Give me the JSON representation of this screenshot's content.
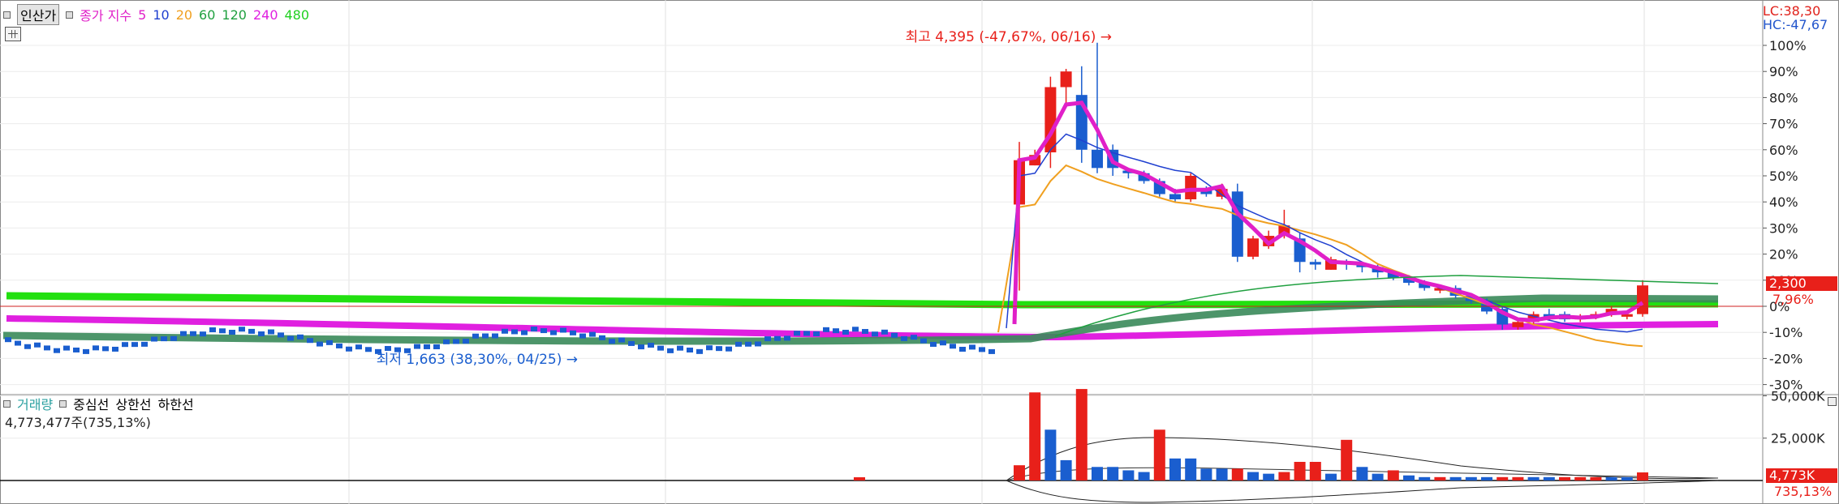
{
  "price_legend": {
    "toggle": "인산가",
    "label": "종가 지수",
    "periods": [
      {
        "label": "5",
        "color": "#e020c8"
      },
      {
        "label": "10",
        "color": "#2040d0"
      },
      {
        "label": "20",
        "color": "#f0a020"
      },
      {
        "label": "60",
        "color": "#20a040"
      },
      {
        "label": "120",
        "color": "#20a040"
      },
      {
        "label": "240",
        "color": "#e020e0"
      },
      {
        "label": "480",
        "color": "#20d020"
      }
    ]
  },
  "vol_legend": {
    "label": "거래량",
    "items": [
      "중심선",
      "상한선",
      "하한선"
    ],
    "readout": "4,773,477주(735,13%)"
  },
  "corner": {
    "lc": "LC:38,30",
    "hc": "HC:-47,67"
  },
  "colors": {
    "up": "#e8201a",
    "down": "#1a5ecf",
    "ma5": "#e020c8",
    "ma10": "#2040d0",
    "ma20": "#f0a020",
    "ma60": "#20a040",
    "ma120": "#3a8a5a",
    "ma240": "#e020e0",
    "ma480": "#22e010"
  },
  "chart_data": {
    "type": "candlestick",
    "yaxis": {
      "ticks": [
        "100%",
        "90%",
        "80%",
        "70%",
        "60%",
        "50%",
        "40%",
        "30%",
        "20%",
        "10%",
        "0%",
        "-10%",
        "-20%",
        "-30%"
      ],
      "values": [
        100,
        90,
        80,
        70,
        60,
        50,
        40,
        30,
        20,
        10,
        0,
        -10,
        -20,
        -30
      ]
    },
    "volume_axis": {
      "ticks": [
        "50,000K",
        "25,000K"
      ],
      "values": [
        50000,
        25000
      ]
    },
    "annotations": {
      "high": "최고 4,395 (-47,67%, 06/16)",
      "low": "최저 1,663 (38,30%, 04/25)",
      "current_price": "2,300",
      "current_pct": "7,96%",
      "current_volume": "4,773K",
      "current_volume_pct": "735,13%"
    },
    "candles": [
      {
        "o": 39,
        "c": 56,
        "h": 63,
        "l": 6
      },
      {
        "o": 54,
        "c": 58,
        "h": 60,
        "l": 54
      },
      {
        "o": 59,
        "c": 84,
        "h": 88,
        "l": 53
      },
      {
        "o": 84,
        "c": 90,
        "h": 91,
        "l": 78
      },
      {
        "o": 81,
        "c": 60,
        "h": 92,
        "l": 55
      },
      {
        "o": 60,
        "c": 53,
        "h": 101,
        "l": 51
      },
      {
        "o": 60,
        "c": 53,
        "h": 62,
        "l": 50
      },
      {
        "o": 52,
        "c": 51,
        "h": 53,
        "l": 49
      },
      {
        "o": 51,
        "c": 48,
        "h": 52,
        "l": 47
      },
      {
        "o": 48,
        "c": 43,
        "h": 49,
        "l": 42
      },
      {
        "o": 43,
        "c": 41,
        "h": 45,
        "l": 40
      },
      {
        "o": 41,
        "c": 50,
        "h": 51,
        "l": 40
      },
      {
        "o": 45,
        "c": 43,
        "h": 46,
        "l": 42
      },
      {
        "o": 42,
        "c": 45,
        "h": 47,
        "l": 41
      },
      {
        "o": 44,
        "c": 19,
        "h": 47,
        "l": 17
      },
      {
        "o": 19,
        "c": 26,
        "h": 27,
        "l": 18
      },
      {
        "o": 23,
        "c": 27,
        "h": 29,
        "l": 22
      },
      {
        "o": 27,
        "c": 31,
        "h": 37,
        "l": 26
      },
      {
        "o": 26,
        "c": 17,
        "h": 28,
        "l": 13
      },
      {
        "o": 17,
        "c": 16,
        "h": 18,
        "l": 14
      },
      {
        "o": 14,
        "c": 18,
        "h": 19,
        "l": 14
      },
      {
        "o": 17,
        "c": 16,
        "h": 18,
        "l": 14
      },
      {
        "o": 16,
        "c": 15,
        "h": 17,
        "l": 13
      },
      {
        "o": 15,
        "c": 13,
        "h": 16,
        "l": 11
      },
      {
        "o": 13,
        "c": 11,
        "h": 14,
        "l": 10
      },
      {
        "o": 11,
        "c": 9,
        "h": 12,
        "l": 8
      },
      {
        "o": 9,
        "c": 7,
        "h": 10,
        "l": 6
      },
      {
        "o": 6,
        "c": 7,
        "h": 8,
        "l": 5
      },
      {
        "o": 7,
        "c": 4,
        "h": 8,
        "l": 3
      },
      {
        "o": 4,
        "c": 2,
        "h": 5,
        "l": 1
      },
      {
        "o": 2,
        "c": -2,
        "h": 3,
        "l": -3
      },
      {
        "o": -1,
        "c": -7,
        "h": 0,
        "l": -9
      },
      {
        "o": -8,
        "c": -6,
        "h": -5,
        "l": -9
      },
      {
        "o": -6,
        "c": -3,
        "h": -2,
        "l": -7
      },
      {
        "o": -3,
        "c": -4,
        "h": -1,
        "l": -5
      },
      {
        "o": -3,
        "c": -5,
        "h": -2,
        "l": -6
      },
      {
        "o": -5,
        "c": -4,
        "h": -3,
        "l": -6
      },
      {
        "o": -4,
        "c": -3,
        "h": -2,
        "l": -5
      },
      {
        "o": -3,
        "c": -1,
        "h": 0,
        "l": -4
      },
      {
        "o": -4,
        "c": -3,
        "h": -2,
        "l": -5
      },
      {
        "o": -3,
        "c": 8,
        "h": 10,
        "l": -4
      }
    ],
    "volumes": [
      {
        "v": 9000,
        "up": true
      },
      {
        "v": 52000,
        "up": true
      },
      {
        "v": 30000,
        "up": false
      },
      {
        "v": 12000,
        "up": false
      },
      {
        "v": 54000,
        "up": true
      },
      {
        "v": 8000,
        "up": false
      },
      {
        "v": 8000,
        "up": false
      },
      {
        "v": 6000,
        "up": false
      },
      {
        "v": 5000,
        "up": false
      },
      {
        "v": 30000,
        "up": true
      },
      {
        "v": 13000,
        "up": false
      },
      {
        "v": 13000,
        "up": false
      },
      {
        "v": 7000,
        "up": false
      },
      {
        "v": 7000,
        "up": false
      },
      {
        "v": 7000,
        "up": true
      },
      {
        "v": 5000,
        "up": false
      },
      {
        "v": 4000,
        "up": false
      },
      {
        "v": 5000,
        "up": true
      },
      {
        "v": 11000,
        "up": true
      },
      {
        "v": 11000,
        "up": true
      },
      {
        "v": 4000,
        "up": false
      },
      {
        "v": 24000,
        "up": true
      },
      {
        "v": 8000,
        "up": false
      },
      {
        "v": 4000,
        "up": false
      },
      {
        "v": 6000,
        "up": true
      },
      {
        "v": 3000,
        "up": false
      },
      {
        "v": 2000,
        "up": false
      },
      {
        "v": 2000,
        "up": true
      },
      {
        "v": 2000,
        "up": false
      },
      {
        "v": 2000,
        "up": false
      },
      {
        "v": 2000,
        "up": false
      },
      {
        "v": 2000,
        "up": true
      },
      {
        "v": 2000,
        "up": true
      },
      {
        "v": 2000,
        "up": false
      },
      {
        "v": 2000,
        "up": false
      },
      {
        "v": 2000,
        "up": true
      },
      {
        "v": 2000,
        "up": true
      },
      {
        "v": 2000,
        "up": true
      },
      {
        "v": 2000,
        "up": false
      },
      {
        "v": 2000,
        "up": false
      },
      {
        "v": 4773,
        "up": true
      }
    ]
  }
}
